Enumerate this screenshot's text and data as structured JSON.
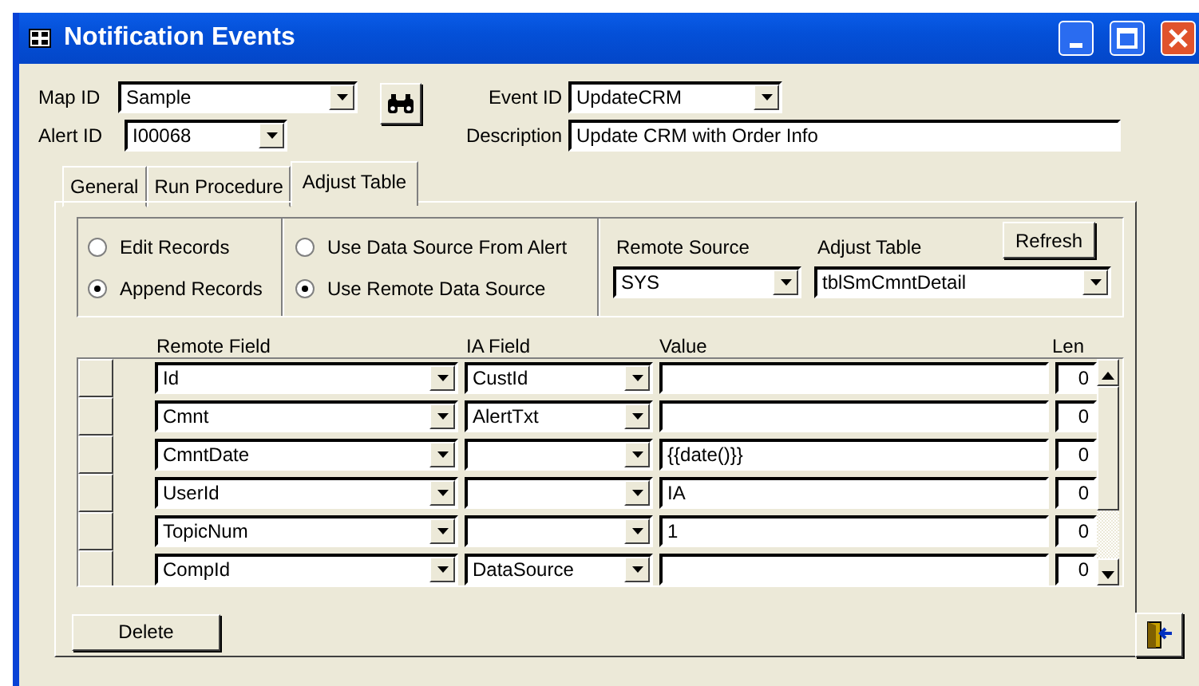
{
  "window": {
    "title": "Notification Events"
  },
  "header": {
    "map_id": {
      "label": "Map ID",
      "value": "Sample"
    },
    "alert_id": {
      "label": "Alert ID",
      "value": "I00068"
    },
    "event_id": {
      "label": "Event ID",
      "value": "UpdateCRM"
    },
    "description": {
      "label": "Description",
      "value": "Update CRM with Order Info"
    }
  },
  "tabs": [
    {
      "label": "General",
      "selected": false
    },
    {
      "label": "Run Procedure",
      "selected": false
    },
    {
      "label": "Adjust Table",
      "selected": true
    }
  ],
  "record_mode": [
    {
      "label": "Edit Records",
      "selected": false
    },
    {
      "label": "Append Records",
      "selected": true
    }
  ],
  "data_source": [
    {
      "label": "Use Data Source From Alert",
      "selected": false
    },
    {
      "label": "Use Remote Data Source",
      "selected": true
    }
  ],
  "remote_source": {
    "label": "Remote Source",
    "value": "SYS"
  },
  "adjust_table": {
    "label": "Adjust Table",
    "value": "tblSmCmntDetail"
  },
  "refresh_button": "Refresh",
  "grid": {
    "columns": [
      "Remote Field",
      "IA Field",
      "Value",
      "Len"
    ],
    "rows": [
      {
        "remote_field": "Id",
        "ia_field": "CustId",
        "value": "",
        "len": "0"
      },
      {
        "remote_field": "Cmnt",
        "ia_field": "AlertTxt",
        "value": "",
        "len": "0"
      },
      {
        "remote_field": "CmntDate",
        "ia_field": "",
        "value": "{{date()}}",
        "len": "0"
      },
      {
        "remote_field": "UserId",
        "ia_field": "",
        "value": "IA",
        "len": "0"
      },
      {
        "remote_field": "TopicNum",
        "ia_field": "",
        "value": "1",
        "len": "0"
      },
      {
        "remote_field": "CompId",
        "ia_field": "DataSource",
        "value": "",
        "len": "0"
      }
    ]
  },
  "delete_button": "Delete"
}
